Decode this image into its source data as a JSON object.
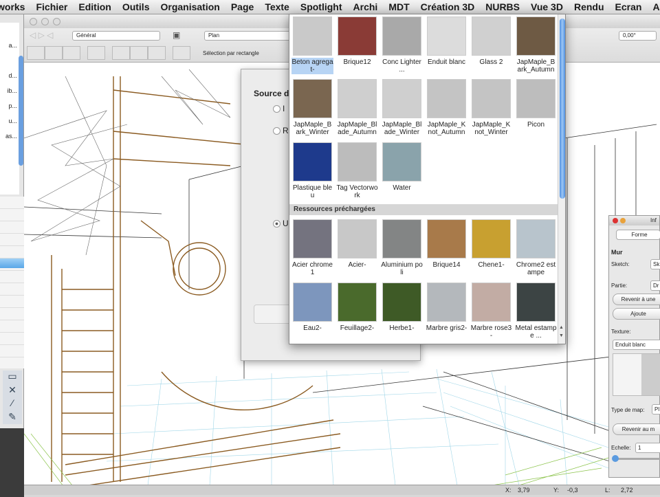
{
  "menubar": {
    "items": [
      "works",
      "Fichier",
      "Edition",
      "Outils",
      "Organisation",
      "Page",
      "Texte",
      "Spotlight",
      "Archi",
      "MDT",
      "Création 3D",
      "NURBS",
      "Vue 3D",
      "Rendu",
      "Ecran",
      "Aide"
    ]
  },
  "left_palette": {
    "items": [
      "",
      "a...",
      "",
      "d...",
      "ib...",
      "p...",
      "u...",
      "as..."
    ]
  },
  "toolbar": {
    "class_popup": "Général",
    "layer_popup": "Plan",
    "angle_value": "0,00°",
    "selection_mode": "Sélection par rectangle"
  },
  "dialog": {
    "title": "Source d",
    "options": [
      "I",
      "R",
      "U"
    ]
  },
  "texture_popup": {
    "section_header": "Ressources préchargées",
    "user_textures": [
      {
        "label": "Beton agregat-",
        "color": "#c9c9c9",
        "selected": true
      },
      {
        "label": "Brique12",
        "color": "#8a3b36"
      },
      {
        "label": "Conc Lighter ...",
        "color": "#a9a9a9"
      },
      {
        "label": "Enduit blanc",
        "color": "#dcdcdc"
      },
      {
        "label": "Glass 2",
        "color": "#d0d0d0"
      },
      {
        "label": "JapMaple_Bark_Autumn",
        "color": "#6e5a44"
      },
      {
        "label": "JapMaple_Bark_Winter",
        "color": "#7a6650"
      },
      {
        "label": "JapMaple_Blade_Autumn",
        "color": "#cfcfcf"
      },
      {
        "label": "JapMaple_Blade_Winter",
        "color": "#cfcfcf"
      },
      {
        "label": "JapMaple_Knot_Autumn",
        "color": "#c4c4c4"
      },
      {
        "label": "JapMaple_Knot_Winter",
        "color": "#c4c4c4"
      },
      {
        "label": "Picon",
        "color": "#bdbdbd"
      },
      {
        "label": "Plastique bleu",
        "color": "#1e3a8c"
      },
      {
        "label": "Tag Vectorwork",
        "color": "#bcbcbc"
      },
      {
        "label": "Water",
        "color": "#8aa3ab"
      }
    ],
    "preloaded_textures": [
      {
        "label": "Acier chrome1",
        "color": "#74737f"
      },
      {
        "label": "Acier-",
        "color": "#c8c8c8"
      },
      {
        "label": "Aluminium poli",
        "color": "#838585"
      },
      {
        "label": "Brique14",
        "color": "#a87a4a"
      },
      {
        "label": "Chene1-",
        "color": "#c8a030"
      },
      {
        "label": "Chrome2 estampe",
        "color": "#b8c4cc"
      },
      {
        "label": "Eau2-",
        "color": "#7d96bd"
      },
      {
        "label": "Feuillage2-",
        "color": "#4a6a2c"
      },
      {
        "label": "Herbe1-",
        "color": "#3e5a26"
      },
      {
        "label": "Marbre gris2-",
        "color": "#b4b8bc"
      },
      {
        "label": "Marbre rose3-",
        "color": "#c2aca4"
      },
      {
        "label": "Metal estampe ...",
        "color": "#3c4444"
      }
    ]
  },
  "info_palette": {
    "title": "Inf",
    "tab": "Forme",
    "object_type": "Mur",
    "sketch_label": "Sketch:",
    "sketch_value": "Sk",
    "partie_label": "Partie:",
    "partie_value": "Dr",
    "revert_button": "Revenir à une",
    "add_button": "Ajoute",
    "texture_label": "Texture:",
    "texture_value": "Enduit blanc",
    "map_type_label": "Type de map:",
    "map_type_value": "Pl",
    "revert_map_button": "Revenir au m",
    "scale_label": "Echelle:",
    "scale_value": "1",
    "scale_slider": 0.05
  },
  "statusbar": {
    "x_label": "X:",
    "x_value": "3,79",
    "y_label": "Y:",
    "y_value": "-0,3",
    "l_label": "L:",
    "l_value": "2,72"
  },
  "colors": {
    "selection": "#b7d4f4",
    "scroll": "#5a9be6",
    "wire_brown": "#8a5a20"
  }
}
